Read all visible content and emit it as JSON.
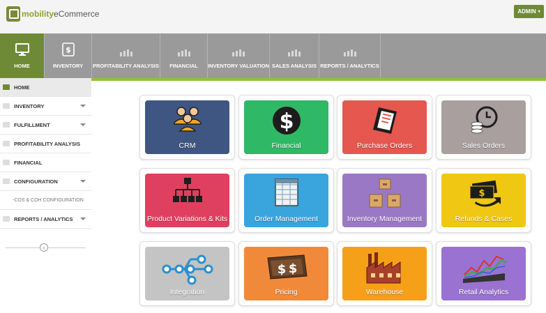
{
  "header": {
    "logo_part1": "mobility",
    "logo_part2": "eCommerce",
    "admin_label": "ADMIN"
  },
  "nav": {
    "tabs": [
      {
        "label": "HOME",
        "icon": "monitor-icon"
      },
      {
        "label": "INVENTORY",
        "icon": "document-dollar-icon"
      },
      {
        "label": "PROFITABILITY ANALYSIS",
        "icon": "bar-chart-icon"
      },
      {
        "label": "FINANCIAL",
        "icon": "bar-chart-icon"
      },
      {
        "label": "INVENTORY VALUATION",
        "icon": "bar-chart-icon"
      },
      {
        "label": "SALES ANALYSIS",
        "icon": "bar-chart-icon"
      },
      {
        "label": "REPORTS / ANALYTICS",
        "icon": "bar-chart-icon"
      }
    ]
  },
  "sidebar": {
    "items": [
      {
        "label": "HOME"
      },
      {
        "label": "INVENTORY"
      },
      {
        "label": "FULFILLMENT"
      },
      {
        "label": "PROFITABILITY ANALYSIS"
      },
      {
        "label": "FINANCIAL"
      },
      {
        "label": "CONFIGURATION"
      },
      {
        "label": "-COS & COH CONFIGURATION"
      },
      {
        "label": "REPORTS / ANALYTICS"
      }
    ],
    "collapse_glyph": "‹"
  },
  "tiles": [
    {
      "label": "CRM",
      "color": "#3f5682",
      "icon": "people-icon"
    },
    {
      "label": "Financial",
      "color": "#2fb866",
      "icon": "dollar-icon"
    },
    {
      "label": "Purchase Orders",
      "color": "#e6574f",
      "icon": "receipt-icon"
    },
    {
      "label": "Sales Orders",
      "color": "#a99f9f",
      "icon": "clock-coins-icon"
    },
    {
      "label": "Product Variations & Kits",
      "color": "#e0405f",
      "icon": "hierarchy-icon"
    },
    {
      "label": "Order Management",
      "color": "#3aa4dd",
      "icon": "spreadsheet-icon"
    },
    {
      "label": "Inventory Management",
      "color": "#9b78c6",
      "icon": "boxes-icon"
    },
    {
      "label": "Refunds & Cases",
      "color": "#f0c712",
      "icon": "money-return-icon"
    },
    {
      "label": "Integration",
      "color": "#c4c4c4",
      "icon": "network-icon"
    },
    {
      "label": "Pricing",
      "color": "#f08a3a",
      "icon": "price-tag-icon"
    },
    {
      "label": "Warehouse",
      "color": "#f6a019",
      "icon": "factory-icon"
    },
    {
      "label": "Retail Analytics",
      "color": "#9a72d2",
      "icon": "line-chart-icon"
    }
  ]
}
